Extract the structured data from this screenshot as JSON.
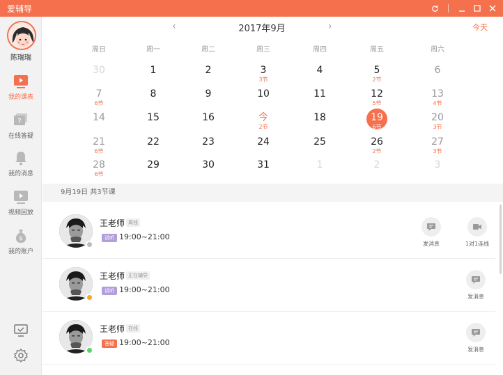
{
  "window": {
    "title": "爱辅导",
    "accent": "#f5704d"
  },
  "sidebar": {
    "user_name": "陈瑞瑞",
    "items": [
      {
        "label": "我的课表",
        "icon": "schedule-icon",
        "active": true
      },
      {
        "label": "在线答疑",
        "icon": "question-icon",
        "active": false
      },
      {
        "label": "我的消息",
        "icon": "bell-icon",
        "active": false
      },
      {
        "label": "视频回放",
        "icon": "play-icon",
        "active": false
      },
      {
        "label": "我的账户",
        "icon": "money-bag-icon",
        "active": false
      }
    ],
    "bottom": [
      "monitor-icon",
      "gear-icon"
    ]
  },
  "calendar": {
    "month_title": "2017年9月",
    "today_label": "今天",
    "weekdays": [
      "周日",
      "周一",
      "周二",
      "周三",
      "周四",
      "周五",
      "周六"
    ],
    "weeks": [
      [
        {
          "day": "30",
          "other": true
        },
        {
          "day": "1"
        },
        {
          "day": "2"
        },
        {
          "day": "3",
          "lessons": "3节"
        },
        {
          "day": "4"
        },
        {
          "day": "5",
          "lessons": "2节"
        },
        {
          "day": "6"
        }
      ],
      [
        {
          "day": "7",
          "lessons": "6节"
        },
        {
          "day": "8"
        },
        {
          "day": "9"
        },
        {
          "day": "10"
        },
        {
          "day": "11"
        },
        {
          "day": "12",
          "lessons": "5节"
        },
        {
          "day": "13",
          "lessons": "4节"
        }
      ],
      [
        {
          "day": "14"
        },
        {
          "day": "15"
        },
        {
          "day": "16"
        },
        {
          "day": "今",
          "lessons": "2节",
          "today": true
        },
        {
          "day": "18"
        },
        {
          "day": "19",
          "lessons": "6节",
          "selected": true
        },
        {
          "day": "20",
          "lessons": "3节"
        }
      ],
      [
        {
          "day": "21",
          "lessons": "6节"
        },
        {
          "day": "22"
        },
        {
          "day": "23"
        },
        {
          "day": "24"
        },
        {
          "day": "25"
        },
        {
          "day": "26",
          "lessons": "2节"
        },
        {
          "day": "27",
          "lessons": "3节"
        }
      ],
      [
        {
          "day": "28",
          "lessons": "6节"
        },
        {
          "day": "29"
        },
        {
          "day": "30"
        },
        {
          "day": "31"
        },
        {
          "day": "1",
          "other": true
        },
        {
          "day": "2",
          "other": true
        },
        {
          "day": "3",
          "other": true
        }
      ]
    ]
  },
  "day_summary": "9月19日  共3节课",
  "lessons": [
    {
      "teacher": "王老师",
      "status": "离线",
      "status_color": "#bbbbbb",
      "tag": "试听",
      "tag_color": "#b39ddb",
      "time": "19:00~21:00",
      "actions": [
        {
          "label": "发消息",
          "icon": "message-icon"
        },
        {
          "label": "1对1连线",
          "icon": "video-icon"
        }
      ]
    },
    {
      "teacher": "王老师",
      "status": "正在辅导",
      "status_color": "#f5a623",
      "tag": "试听",
      "tag_color": "#b39ddb",
      "time": "19:00~21:00",
      "actions": [
        {
          "label": "发消息",
          "icon": "message-icon"
        }
      ]
    },
    {
      "teacher": "王老师",
      "status": "在线",
      "status_color": "#4cd964",
      "tag": "答疑",
      "tag_color": "#f5704d",
      "time": "19:00~21:00",
      "actions": [
        {
          "label": "发消息",
          "icon": "message-icon"
        }
      ]
    }
  ]
}
